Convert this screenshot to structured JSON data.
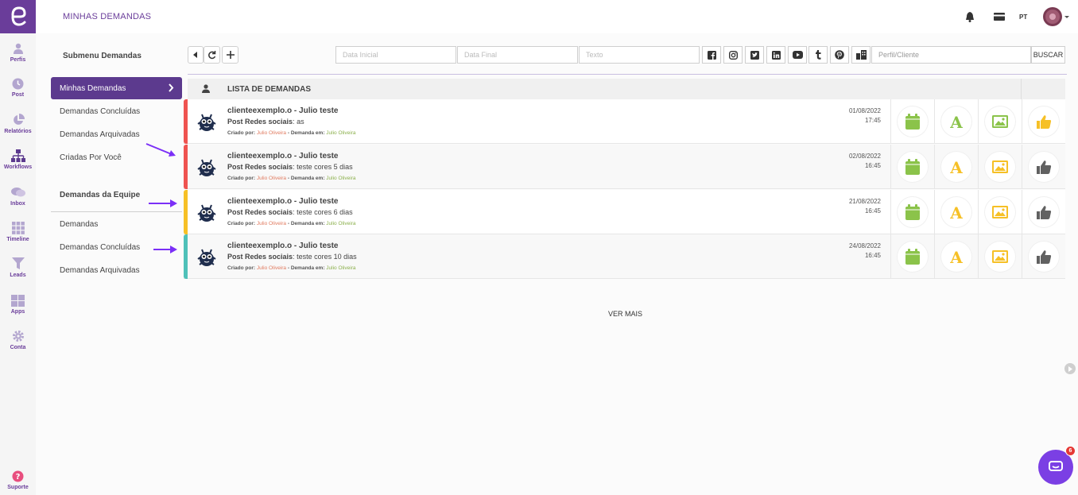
{
  "app": {
    "page_title": "MINHAS DEMANDAS",
    "lang": "PT"
  },
  "rail": {
    "items": [
      {
        "label": "Perfis",
        "icon": "user-icon"
      },
      {
        "label": "Post",
        "icon": "clock-icon"
      },
      {
        "label": "Relatórios",
        "icon": "pie-chart-icon"
      },
      {
        "label": "Workflows",
        "icon": "sitemap-icon"
      },
      {
        "label": "Inbox",
        "icon": "chat-bubbles-icon"
      },
      {
        "label": "Timeline",
        "icon": "grid-icon"
      },
      {
        "label": "Leads",
        "icon": "funnel-icon"
      },
      {
        "label": "Apps",
        "icon": "apps-icon"
      },
      {
        "label": "Conta",
        "icon": "gear-icon"
      }
    ],
    "support_label": "Suporte"
  },
  "submenu": {
    "title": "Submenu Demandas",
    "items": [
      "Minhas Demandas",
      "Demandas Concluídas",
      "Demandas Arquivadas",
      "Criadas Por Você"
    ],
    "team_title": "Demandas da Equipe",
    "team_items": [
      "Demandas",
      "Demandas Concluídas",
      "Demandas Arquivadas"
    ]
  },
  "toolbar": {
    "start_date_placeholder": "Data Inicial",
    "end_date_placeholder": "Data Final",
    "text_placeholder": "Texto",
    "profile_placeholder": "Perfil/Cliente",
    "search_label": "BUSCAR"
  },
  "list": {
    "header": "LISTA DE DEMANDAS",
    "created_by_label": "Criado por:",
    "demand_in_label": "Demanda em:",
    "rows": [
      {
        "title": "clienteexemplo.o - Julio teste",
        "type": "Post Redes sociais",
        "desc": "as",
        "created_by": "Julio Oliveira",
        "demand_in": "Julio Oliveira",
        "date": "01/08/2022",
        "time": "17:45",
        "bar_color": "#ef5350"
      },
      {
        "title": "clienteexemplo.o - Julio teste",
        "type": "Post Redes sociais",
        "desc": "teste cores 5 dias",
        "created_by": "Julio Oliveira",
        "demand_in": "Julio Oliveira",
        "date": "02/08/2022",
        "time": "16:45",
        "bar_color": "#ef5350"
      },
      {
        "title": "clienteexemplo.o - Julio teste",
        "type": "Post Redes sociais",
        "desc": "teste cores 6 dias",
        "created_by": "Julio Oliveira",
        "demand_in": "Julio Oliveira",
        "date": "21/08/2022",
        "time": "16:45",
        "bar_color": "#f6c026"
      },
      {
        "title": "clienteexemplo.o - Julio teste",
        "type": "Post Redes sociais",
        "desc": "teste cores 10 dias",
        "created_by": "Julio Oliveira",
        "demand_in": "Julio Oliveira",
        "date": "24/08/2022",
        "time": "16:45",
        "bar_color": "#4fc1b9"
      }
    ],
    "more_label": "VER MAIS"
  },
  "chat": {
    "badge": "6"
  },
  "colors": {
    "brand": "#6a3d9a",
    "green": "#8bc34a",
    "yellow": "#f6c026",
    "grey": "#616161"
  }
}
